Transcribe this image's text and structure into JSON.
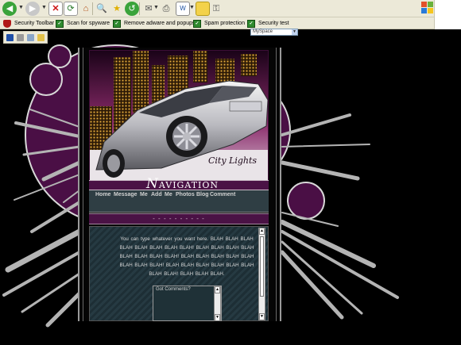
{
  "browser": {
    "security_toolbar": {
      "items": [
        {
          "label": "Security Toolbar",
          "icon": "shield-icon"
        },
        {
          "label": "Scan for spyware",
          "icon": "scan-icon"
        },
        {
          "label": "Remove adware and popups",
          "icon": "remove-adware-icon"
        },
        {
          "label": "Spam protection",
          "icon": "spam-protection-icon"
        },
        {
          "label": "Security test",
          "icon": "security-test-icon"
        }
      ]
    },
    "search_field_value": "MySpace"
  },
  "profile": {
    "banner_caption": "City Lights",
    "nav_title_initial": "N",
    "nav_title_rest": "AVIGATION",
    "nav_links": [
      "Home",
      "Message",
      "Me",
      "Add",
      "Me",
      "Photos",
      "Blog",
      "Comment"
    ],
    "dots": "- - - - - - - - - -",
    "body_text": "You can type whatever you want here. BLAH BLAH BLAH BLAH BLAH BLAH BLAH BLAH! BLAH BLAH BLAH BLAH BLAH BLAH BLAH BLAH! BLAH BLAH BLAH BLAH BLAH BLAH BLAH BLAH! BLAH BLAH BLAH BLAH BLAH BLAH BLAH BLAH! BLAH BLAH BLAH.",
    "comments_label": "Got Comments?"
  },
  "colors": {
    "purple": "#4a1245",
    "teal": "#2f3e44",
    "background": "#000000"
  }
}
